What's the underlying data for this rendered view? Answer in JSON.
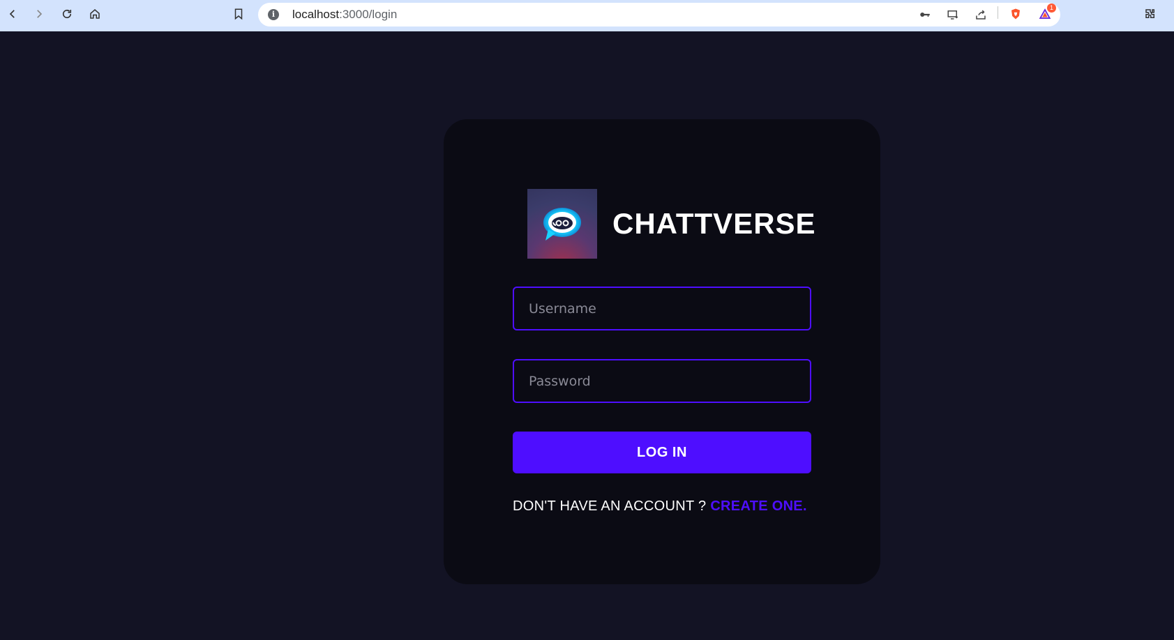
{
  "browser": {
    "url_host": "localhost",
    "url_path": ":3000/login",
    "brave_rewards_count": "1"
  },
  "brand": {
    "name": "CHATTVERSE"
  },
  "form": {
    "username_placeholder": "Username",
    "password_placeholder": "Password",
    "login_label": "LOG IN",
    "signup_prompt": "DON'T HAVE AN ACCOUNT ? ",
    "signup_link": "CREATE ONE."
  },
  "colors": {
    "page_bg": "#131324",
    "card_bg": "#0b0b14",
    "accent": "#4e0eff"
  }
}
